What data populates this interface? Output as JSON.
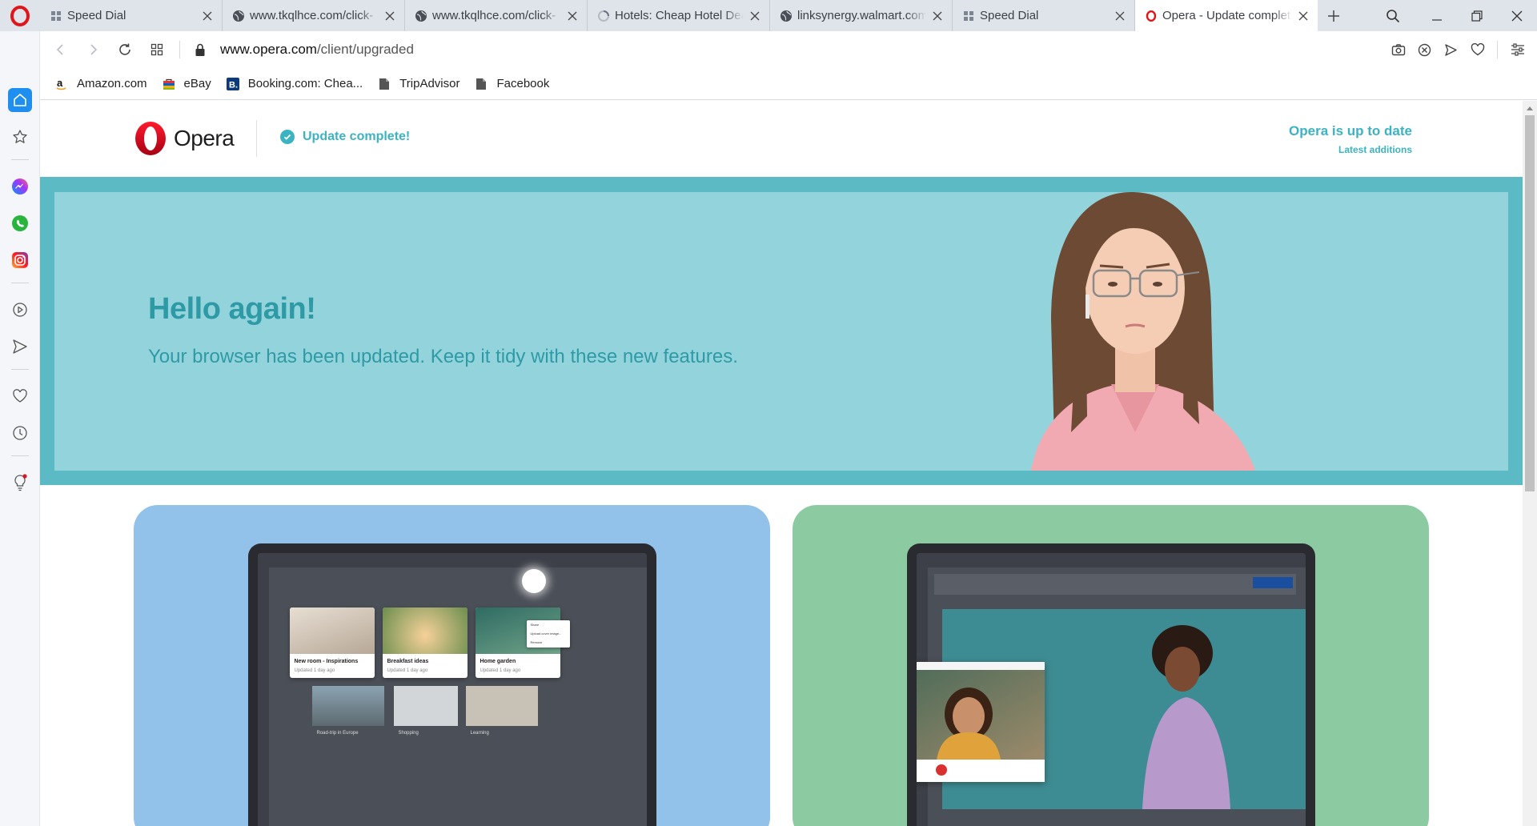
{
  "tabs": [
    {
      "title": "Speed Dial",
      "icon": "speed-dial-icon"
    },
    {
      "title": "www.tkqlhce.com/click-",
      "icon": "globe-icon"
    },
    {
      "title": "www.tkqlhce.com/click-",
      "icon": "globe-icon"
    },
    {
      "title": "Hotels: Cheap Hotel Dea",
      "icon": "loading-icon"
    },
    {
      "title": "linksynergy.walmart.com",
      "icon": "globe-icon"
    },
    {
      "title": "Speed Dial",
      "icon": "speed-dial-icon"
    },
    {
      "title": "Opera - Update complet",
      "icon": "opera-icon",
      "active": true
    }
  ],
  "address": {
    "url_host": "www.opera.com",
    "url_path": "/client/upgraded"
  },
  "bookmarks": [
    {
      "label": "Amazon.com",
      "icon": "amazon-icon"
    },
    {
      "label": "eBay",
      "icon": "ebay-icon"
    },
    {
      "label": "Booking.com: Chea...",
      "icon": "booking-icon"
    },
    {
      "label": "TripAdvisor",
      "icon": "file-icon"
    },
    {
      "label": "Facebook",
      "icon": "file-icon"
    }
  ],
  "page": {
    "logo_text": "Opera",
    "update_status": "Update complete!",
    "up_to_date": "Opera is up to date",
    "latest_additions": "Latest additions",
    "hero_title": "Hello again!",
    "hero_subtitle": "Your browser has been updated. Keep it tidy with these new features."
  },
  "pinboard_demo": {
    "cards": [
      {
        "title": "New room - Inspirations",
        "sub": "Updated 1 day ago"
      },
      {
        "title": "Breakfast ideas",
        "sub": "Updated 1 day ago"
      },
      {
        "title": "Home garden",
        "sub": "Updated 1 day ago"
      }
    ],
    "menu": [
      "Share",
      "Upload cover image...",
      "Remove"
    ],
    "bottom": [
      "Road-trip in Europe",
      "Shopping",
      "Learning"
    ]
  },
  "colors": {
    "accent": "#3bb3c1",
    "hero_bg": "#93d4dc",
    "hero_frame": "#5bbac4",
    "opera_red": "#e0151c",
    "card_blue": "#92c1ea",
    "card_green": "#8ccaa2"
  }
}
